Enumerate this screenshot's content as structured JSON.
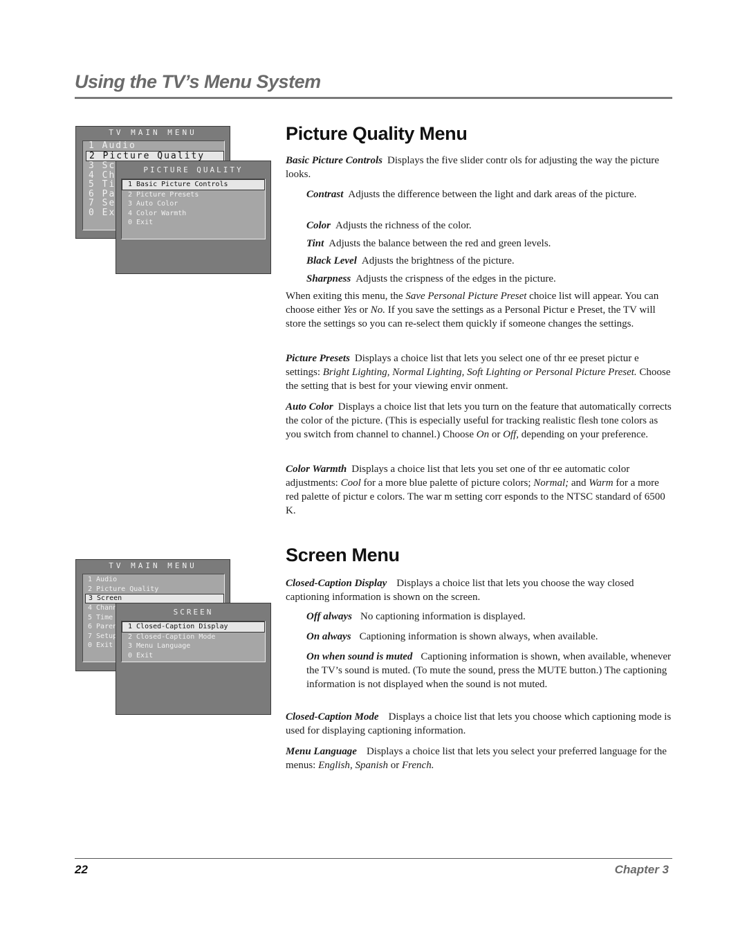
{
  "header": {
    "running_title": "Using the TV’s Menu System"
  },
  "footer": {
    "page_number": "22",
    "chapter": "Chapter 3"
  },
  "figures": {
    "picture_quality": {
      "main_menu": {
        "title": "TV MAIN MENU",
        "items": [
          "1 Audio",
          "2 Picture Quality",
          "3 Sc",
          "4 Ch",
          "5 Ti",
          "6 Pa",
          "7 Se",
          "0 Ex"
        ],
        "selected_index": 1
      },
      "submenu": {
        "title": "PICTURE QUALITY",
        "items": [
          "1 Basic Picture Controls",
          "2 Picture Presets",
          "3 Auto Color",
          "4 Color Warmth",
          "0 Exit"
        ],
        "selected_index": 0
      }
    },
    "screen": {
      "main_menu": {
        "title": "TV MAIN MENU",
        "items": [
          "1 Audio",
          "2 Picture Quality",
          "3 Screen",
          "4 Chann",
          "5 Time",
          "6 Paren",
          "7 Setup",
          "0 Exit"
        ],
        "selected_index": 2
      },
      "submenu": {
        "title": "SCREEN",
        "items": [
          "1 Closed-Caption Display",
          "2 Closed-Caption Mode",
          "3 Menu Language",
          "0 Exit"
        ],
        "selected_index": 0
      }
    }
  },
  "picture_quality_section": {
    "heading": "Picture Quality Menu",
    "basic_controls": {
      "term": "Basic Picture Controls",
      "text": "Displays the five slider contr ols for adjusting the way the picture looks."
    },
    "contrast": {
      "term": "Contrast",
      "text": "Adjusts the difference between the light and dark areas of the picture."
    },
    "color": {
      "term": "Color",
      "text": "Adjusts the richness of the color."
    },
    "tint": {
      "term": "Tint",
      "text": "Adjusts the balance between the red and green levels."
    },
    "black_level": {
      "term": "Black Level",
      "text": "Adjusts the brightness of the picture."
    },
    "sharpness": {
      "term": "Sharpness",
      "text": "Adjusts the crispness of the edges in the picture."
    },
    "exiting": {
      "t1": "When exiting this menu, the ",
      "i1": "Save Personal Picture Preset",
      "t2": " choice list will appear. You can choose either ",
      "i2": "Yes",
      "t3": " or ",
      "i3": "No.",
      "t4": " If you save the settings as a Personal Pictur e Preset, the TV will store the settings so you can re-select them quickly if someone changes the settings."
    },
    "picture_presets": {
      "term": "Picture Presets",
      "t1": "Displays a choice list that lets you select one of thr ee preset pictur e settings: ",
      "i1": "Bright Lighting, Normal Lighting, Soft Lighting or Personal Picture Preset.",
      "t2": " Choose the setting that is best for your viewing envir onment."
    },
    "auto_color": {
      "term": "Auto Color",
      "t1": "Displays a choice list that lets you turn on the feature that automatically corrects the color of the picture. (This is especially useful for tracking realistic flesh tone colors as you switch from channel to channel.) Choose ",
      "i1": "On",
      "t2": " or ",
      "i2": "Off,",
      "t3": " depending on your preference."
    },
    "color_warmth": {
      "term": "Color Warmth",
      "t1": "Displays a choice list that lets you set one of thr ee automatic color adjustments: ",
      "i1": "Cool",
      "t2": " for a more blue palette of picture colors; ",
      "i2": "Normal;",
      "t3": " and ",
      "i3": "Warm",
      "t4": " for a more red palette of pictur e colors. The war m setting corr esponds to the NTSC standard of 6500 K."
    }
  },
  "screen_section": {
    "heading": "Screen Menu",
    "cc_display": {
      "term": "Closed-Caption Display",
      "text": "Displays a choice list that lets you choose the way closed captioning information is shown on the screen."
    },
    "off_always": {
      "term": "Off always",
      "text": "No captioning information is displayed."
    },
    "on_always": {
      "term": "On always",
      "text": "Captioning information is shown always, when available."
    },
    "on_muted": {
      "term": "On when sound is muted",
      "text": "Captioning information is shown, when available, whenever the TV’s sound is muted. (To mute the sound, press the MUTE button.) The captioning information is not displayed when the sound is not muted."
    },
    "cc_mode": {
      "term": "Closed-Caption Mode",
      "text": "Displays a choice list that lets you choose which captioning mode is used for displaying captioning information."
    },
    "menu_language": {
      "term": "Menu Language",
      "t1": "Displays a choice list that lets you select your preferred language for the menus: ",
      "i1": "English",
      "t2": ", ",
      "i2": "Spanish",
      "t3": " or ",
      "i3": "French."
    }
  }
}
